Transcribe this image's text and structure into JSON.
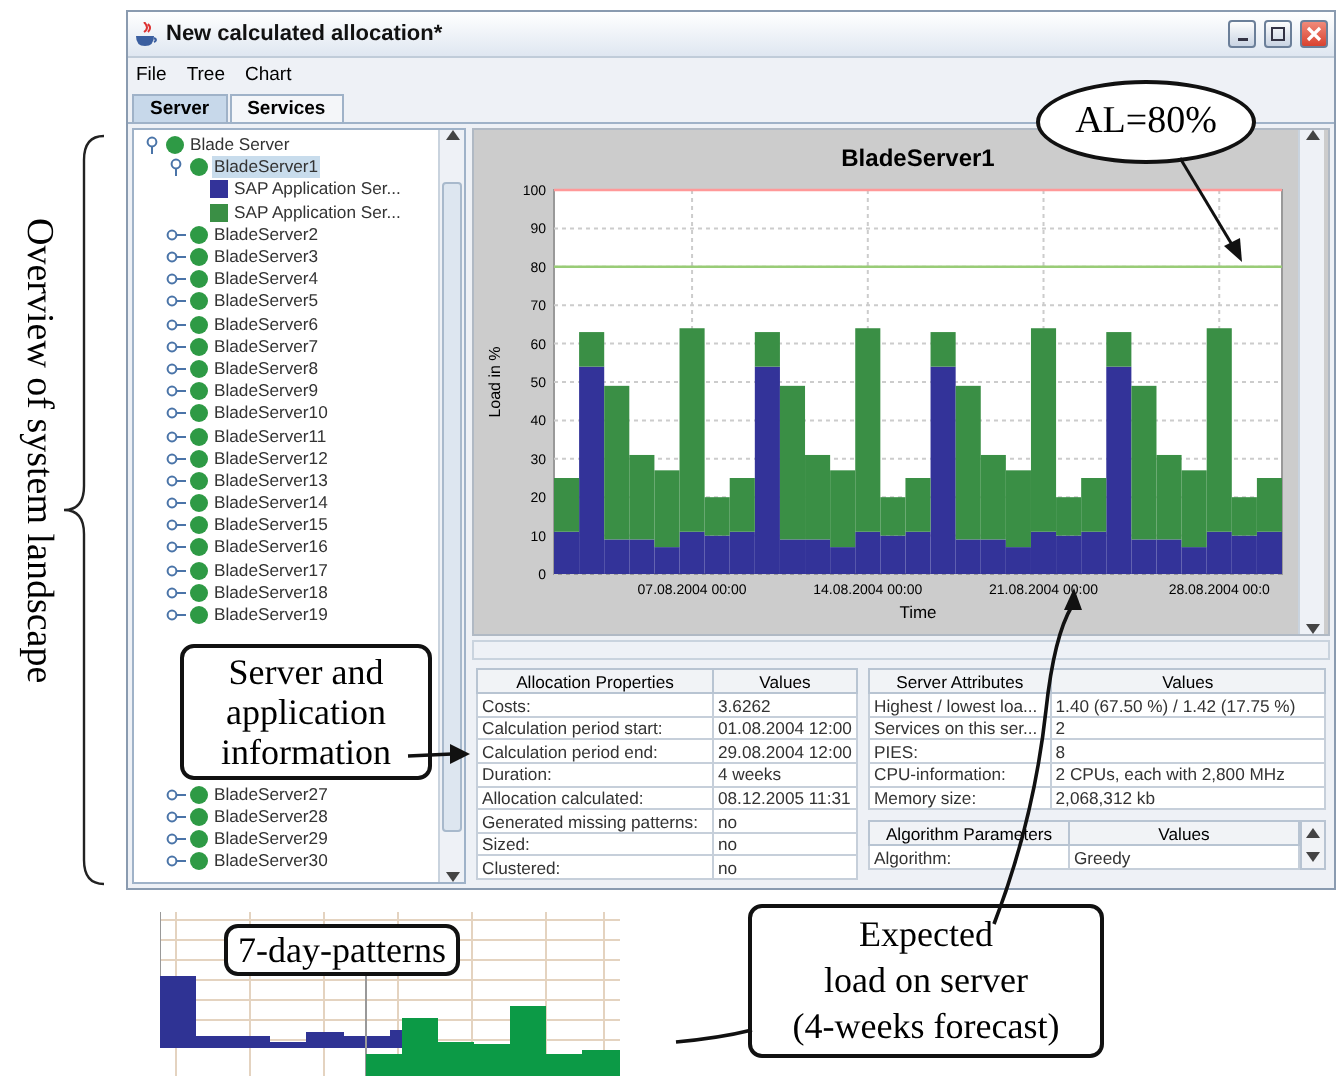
{
  "window": {
    "title": "New calculated allocation*"
  },
  "menu": [
    "File",
    "Tree",
    "Chart"
  ],
  "tabs": [
    {
      "label": "Server",
      "selected": true
    },
    {
      "label": "Services",
      "selected": false
    }
  ],
  "tree": {
    "items": [
      {
        "label": "Blade Server",
        "kind": "server",
        "expanded": true,
        "selected": false,
        "children": [
          {
            "label": "BladeServer1",
            "kind": "server",
            "expanded": true,
            "selected": true,
            "children": [
              {
                "label": "SAP Application Ser...",
                "kind": "application",
                "color": "#333399",
                "selected": false
              },
              {
                "label": "SAP Application Ser...",
                "kind": "application",
                "color": "#3a8f45",
                "selected": false
              }
            ]
          },
          {
            "label": "BladeServer2",
            "kind": "server",
            "expanded": false,
            "selected": false
          },
          {
            "label": "BladeServer3",
            "kind": "server",
            "expanded": false,
            "selected": false
          },
          {
            "label": "BladeServer4",
            "kind": "server",
            "expanded": false,
            "selected": false
          },
          {
            "label": "BladeServer5",
            "kind": "server",
            "expanded": false,
            "selected": false
          },
          {
            "label": "BladeServer6",
            "kind": "server",
            "expanded": false,
            "selected": false
          },
          {
            "label": "BladeServer7",
            "kind": "server",
            "expanded": false,
            "selected": false
          },
          {
            "label": "BladeServer8",
            "kind": "server",
            "expanded": false,
            "selected": false
          },
          {
            "label": "BladeServer9",
            "kind": "server",
            "expanded": false,
            "selected": false
          },
          {
            "label": "BladeServer10",
            "kind": "server",
            "expanded": false,
            "selected": false
          },
          {
            "label": "BladeServer11",
            "kind": "server",
            "expanded": false,
            "selected": false
          },
          {
            "label": "BladeServer12",
            "kind": "server",
            "expanded": false,
            "selected": false
          },
          {
            "label": "BladeServer13",
            "kind": "server",
            "expanded": false,
            "selected": false
          },
          {
            "label": "BladeServer14",
            "kind": "server",
            "expanded": false,
            "selected": false
          },
          {
            "label": "BladeServer15",
            "kind": "server",
            "expanded": false,
            "selected": false
          },
          {
            "label": "BladeServer16",
            "kind": "server",
            "expanded": false,
            "selected": false
          },
          {
            "label": "BladeServer17",
            "kind": "server",
            "expanded": false,
            "selected": false
          },
          {
            "label": "BladeServer18",
            "kind": "server",
            "expanded": false,
            "selected": false
          },
          {
            "label": "BladeServer19",
            "kind": "server",
            "expanded": false,
            "selected": false
          },
          {
            "kind": "covered"
          },
          {
            "kind": "covered"
          },
          {
            "kind": "covered"
          },
          {
            "kind": "covered"
          },
          {
            "kind": "covered"
          },
          {
            "kind": "covered"
          },
          {
            "kind": "covered"
          },
          {
            "label": "BladeServer27",
            "kind": "server",
            "expanded": false,
            "selected": false
          },
          {
            "label": "BladeServer28",
            "kind": "server",
            "expanded": false,
            "selected": false
          },
          {
            "label": "BladeServer29",
            "kind": "server",
            "expanded": false,
            "selected": false
          },
          {
            "label": "BladeServer30",
            "kind": "server",
            "expanded": false,
            "selected": false
          }
        ]
      }
    ]
  },
  "chart": {
    "chart_data": {
      "type": "bar",
      "title": "BladeServer1",
      "xlabel": "Time",
      "ylabel": "Load in %",
      "stacked": true,
      "grid": true,
      "categories": [
        null,
        null,
        null,
        null,
        null,
        "07.08.2004 00:00",
        null,
        null,
        null,
        null,
        null,
        null,
        "14.08.2004 00:00",
        null,
        null,
        null,
        null,
        null,
        null,
        "21.08.2004 00:00",
        null,
        null,
        null,
        null,
        null,
        null,
        "28.08.2004 00:0",
        null,
        null
      ],
      "ylim": [
        0,
        100
      ],
      "yticks": [
        0,
        10,
        20,
        30,
        40,
        50,
        60,
        70,
        80,
        90,
        100
      ],
      "series": [
        {
          "color": "#333399",
          "values": [
            11,
            54,
            9,
            9,
            7,
            11,
            10,
            11,
            54,
            9,
            9,
            7,
            11,
            10,
            11,
            54,
            9,
            9,
            7,
            11,
            10,
            11,
            54,
            9,
            9,
            7,
            11,
            10,
            11
          ]
        },
        {
          "color": "#3a8f45",
          "values": [
            14,
            9,
            40,
            22,
            20,
            53,
            10,
            14,
            9,
            40,
            22,
            20,
            53,
            10,
            14,
            9,
            40,
            22,
            20,
            53,
            10,
            14,
            9,
            40,
            22,
            20,
            53,
            10,
            14
          ]
        }
      ],
      "ref_lines": [
        {
          "axis": "y",
          "value": 100,
          "color": "#ff9999"
        },
        {
          "axis": "y",
          "value": 80,
          "color": "#99cc77"
        }
      ]
    }
  },
  "allocation_table": {
    "columns": [
      "Allocation Properties",
      "Values"
    ],
    "rows": [
      [
        "Costs:",
        "3.6262"
      ],
      [
        "Calculation period start:",
        "01.08.2004 12:00"
      ],
      [
        "Calculation period end:",
        "29.08.2004 12:00"
      ],
      [
        "Duration:",
        "4 weeks"
      ],
      [
        "Allocation calculated:",
        "08.12.2005 11:31"
      ],
      [
        "Generated missing patterns:",
        "no"
      ],
      [
        "Sized:",
        "no"
      ],
      [
        "Clustered:",
        "no"
      ]
    ]
  },
  "server_table": {
    "columns": [
      "Server Attributes",
      "Values"
    ],
    "rows": [
      [
        "Highest / lowest loa...",
        "1.40  (67.50 %) / 1.42  (17.75 %)"
      ],
      [
        "Services on this ser...",
        "2"
      ],
      [
        "PIES:",
        "8"
      ],
      [
        "CPU-information:",
        "2 CPUs, each with 2,800 MHz"
      ],
      [
        "Memory size:",
        "2,068,312 kb"
      ]
    ]
  },
  "algorithm_table": {
    "columns": [
      "Algorithm Parameters",
      "Values"
    ],
    "rows": [
      [
        "Algorithm:",
        "Greedy"
      ]
    ]
  },
  "annotations": {
    "landscape_label": "Overview of system landscape",
    "threshold_callout": "AL=80%",
    "info_callout": "Server and\napplication\ninformation",
    "forecast_callout": "Expected\nload on server\n(4-weeks forecast)",
    "patterns_label": "7-day-patterns"
  }
}
